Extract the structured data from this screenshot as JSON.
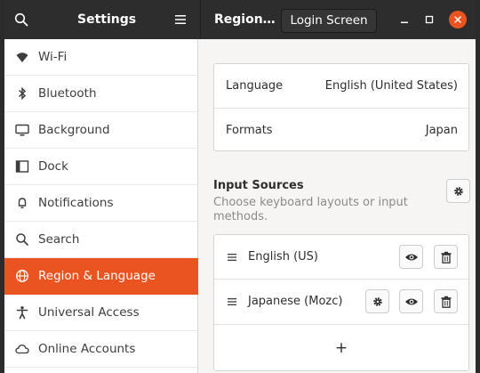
{
  "header": {
    "sidebar_title": "Settings",
    "page_title": "Region…",
    "login_button": "Login Screen"
  },
  "sidebar": {
    "items": [
      {
        "label": "Wi-Fi",
        "icon": "wifi-icon"
      },
      {
        "label": "Bluetooth",
        "icon": "bluetooth-icon"
      },
      {
        "label": "Background",
        "icon": "monitor-icon"
      },
      {
        "label": "Dock",
        "icon": "dock-icon"
      },
      {
        "label": "Notifications",
        "icon": "bell-icon"
      },
      {
        "label": "Search",
        "icon": "search-icon"
      },
      {
        "label": "Region & Language",
        "icon": "globe-icon",
        "active": true
      },
      {
        "label": "Universal Access",
        "icon": "accessibility-icon"
      },
      {
        "label": "Online Accounts",
        "icon": "cloud-icon"
      }
    ]
  },
  "region": {
    "language_label": "Language",
    "language_value": "English (United States)",
    "formats_label": "Formats",
    "formats_value": "Japan"
  },
  "input_sources": {
    "title": "Input Sources",
    "description": "Choose keyboard layouts or input methods.",
    "sources": [
      {
        "name": "English (US)"
      },
      {
        "name": "Japanese (Mozc)"
      }
    ],
    "add_symbol": "+"
  },
  "colors": {
    "accent": "#e95420",
    "headerbar": "#2d2d2d"
  }
}
